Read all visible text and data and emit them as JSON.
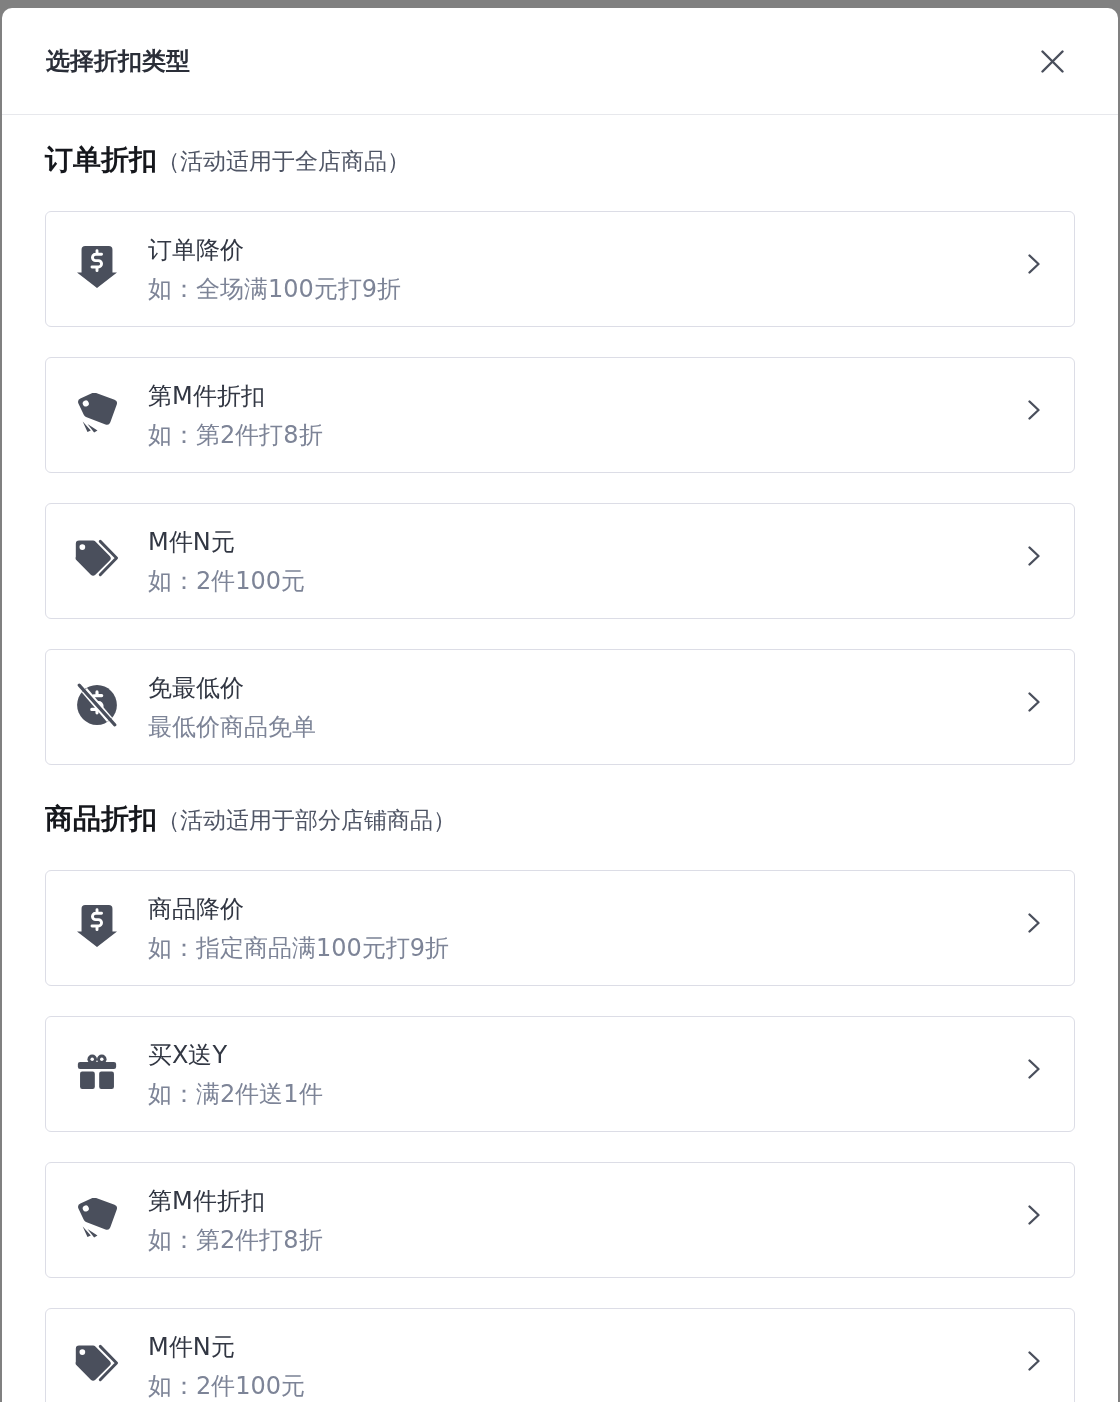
{
  "dialog": {
    "title": "选择折扣类型"
  },
  "sections": [
    {
      "heading": "订单折扣",
      "note": "（活动适用于全店商品）",
      "options": [
        {
          "kind": "reduce",
          "title": "订单降价",
          "example": "如：全场满100元打9折"
        },
        {
          "kind": "nth",
          "title": "第M件折扣",
          "example": "如：第2件打8折"
        },
        {
          "kind": "bundle",
          "title": "M件N元",
          "example": "如：2件100元"
        },
        {
          "kind": "cheapest",
          "title": "免最低价",
          "example": "最低价商品免单"
        }
      ]
    },
    {
      "heading": "商品折扣",
      "note": "（活动适用于部分店铺商品）",
      "options": [
        {
          "kind": "reduce",
          "title": "商品降价",
          "example": "如：指定商品满100元打9折"
        },
        {
          "kind": "gift",
          "title": "买X送Y",
          "example": "如：满2件送1件"
        },
        {
          "kind": "nth",
          "title": "第M件折扣",
          "example": "如：第2件打8折"
        },
        {
          "kind": "bundle",
          "title": "M件N元",
          "example": "如：2件100元"
        }
      ]
    }
  ]
}
